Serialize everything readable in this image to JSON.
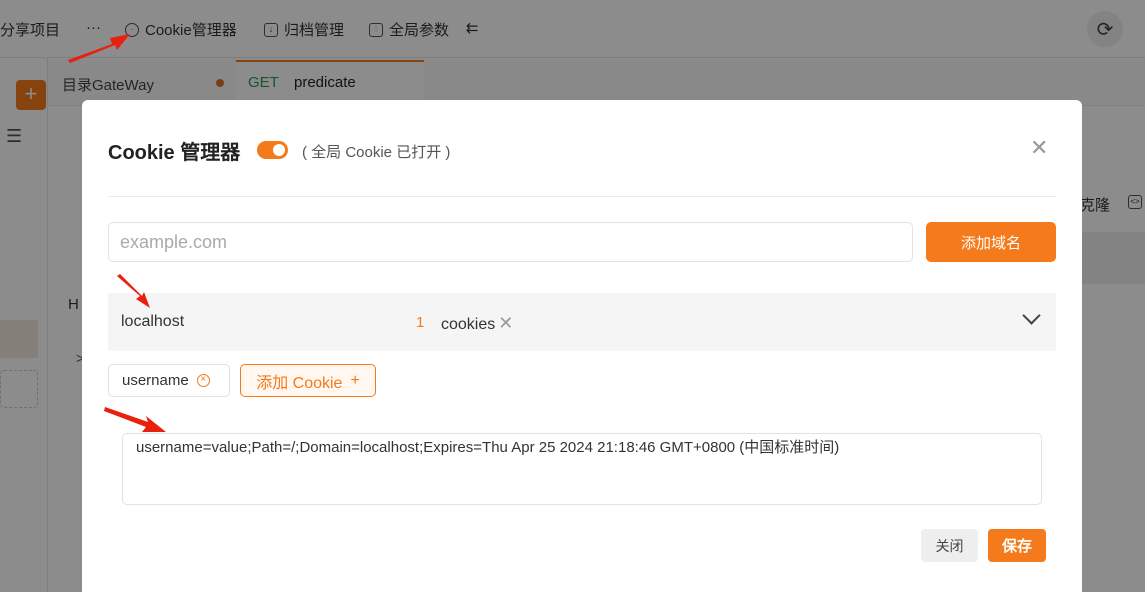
{
  "toolbar": {
    "share": "分享项目",
    "more": "···",
    "cookie": "Cookie管理器",
    "archive": "归档管理",
    "global_params": "全局参数",
    "collapse": "⇇",
    "refresh": "⟳"
  },
  "tabs": {
    "directory": "目录GateWay",
    "active_method": "GET",
    "active_name": "predicate"
  },
  "background": {
    "clone": "克隆",
    "code": "<>",
    "h": "H"
  },
  "modal": {
    "title": "Cookie 管理器",
    "subtitle": "( 全局 Cookie 已打开 )",
    "close_icon": "✕",
    "domain_placeholder": "example.com",
    "add_domain_label": "添加域名",
    "domain": {
      "host": "localhost",
      "count": "1",
      "cookies_label": "cookies",
      "delete": "✕"
    },
    "cookie_chip": "username",
    "add_cookie_label": "添加 Cookie",
    "add_cookie_plus": "+",
    "cookie_value": "username=value;Path=/;Domain=localhost;Expires=Thu Apr 25 2024 21:18:46 GMT+0800 (中国标准时间)",
    "cancel_label": "关闭",
    "save_label": "保存"
  },
  "colors": {
    "accent": "#f47a1b",
    "method_get": "#2e9a4d",
    "annotation_arrow": "#e8200e"
  }
}
